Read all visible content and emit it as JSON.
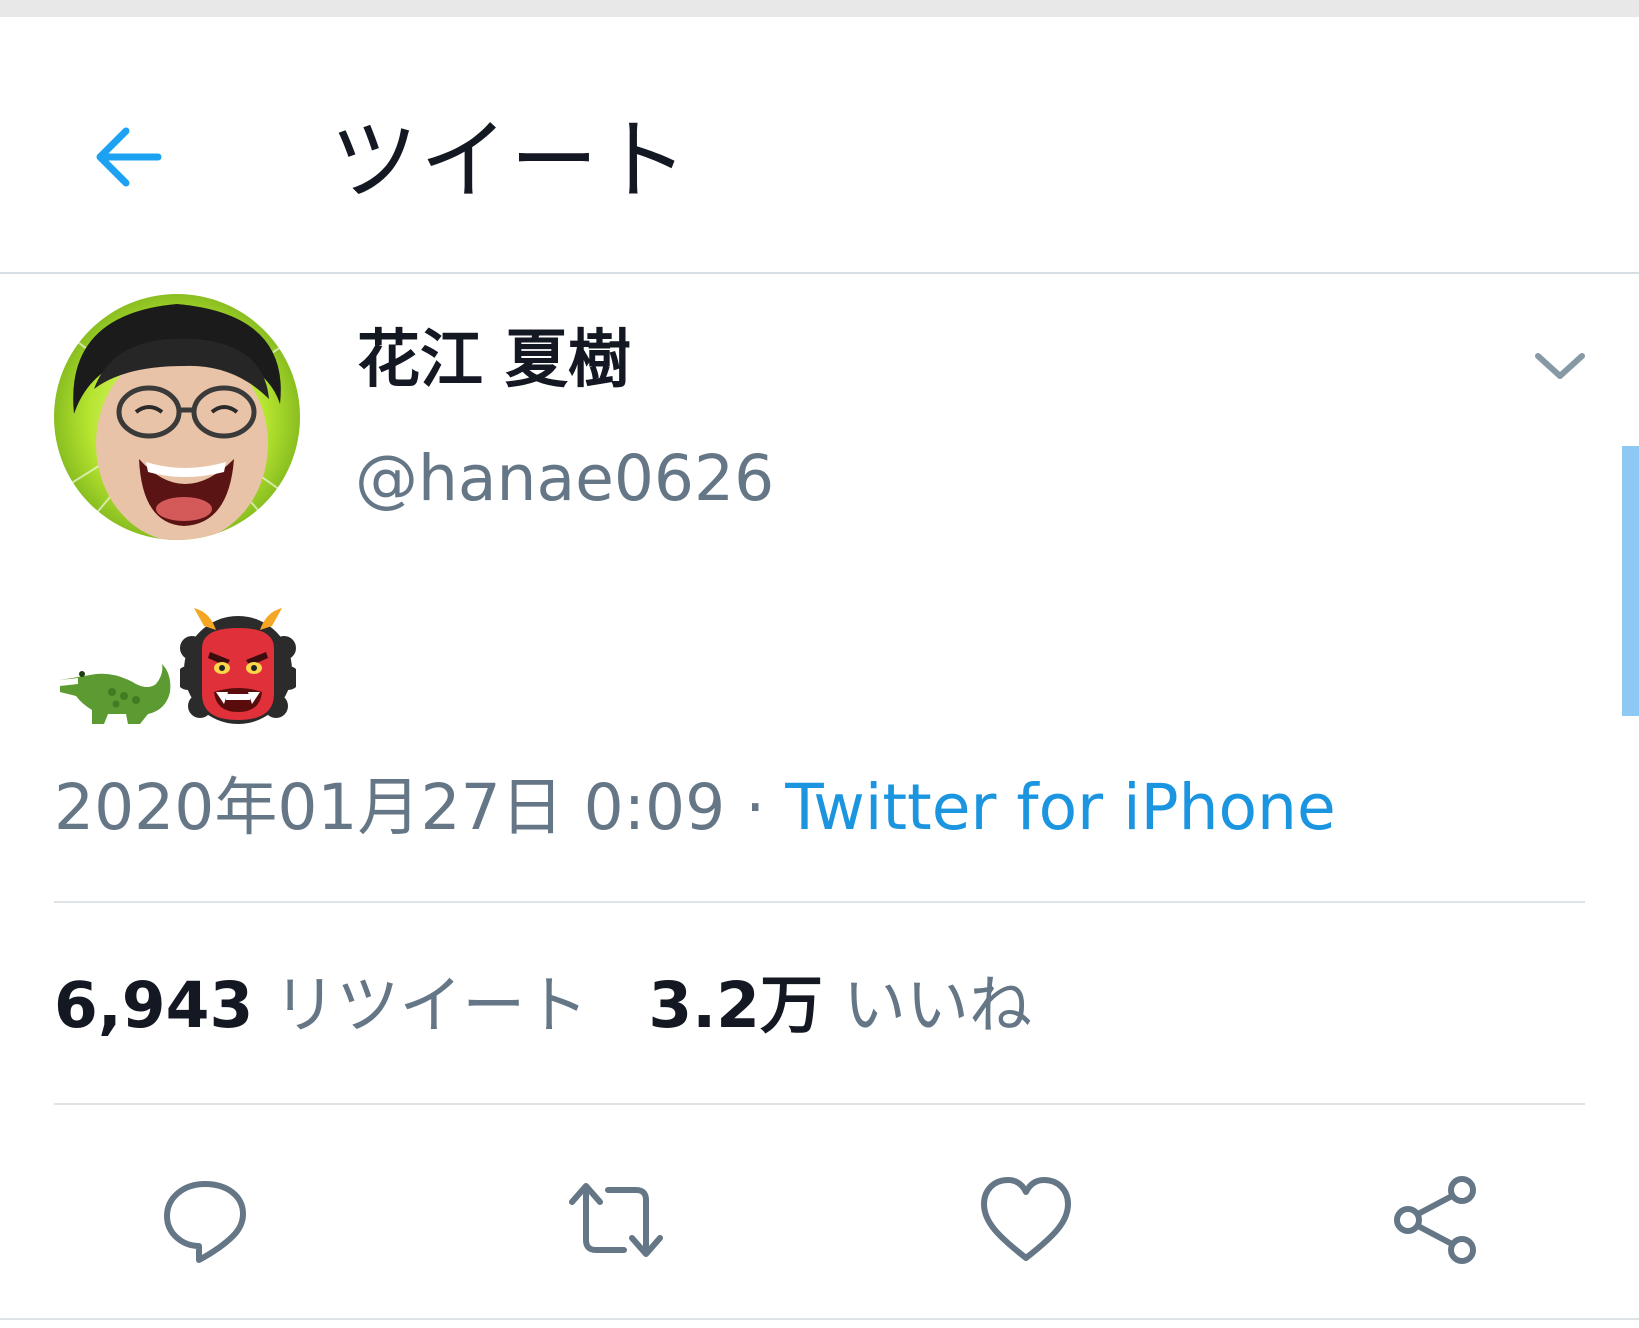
{
  "header": {
    "title": "ツイート",
    "back_icon": "arrow-left-icon",
    "accent_color": "#1da1f2"
  },
  "tweet": {
    "author": {
      "display_name": "花江 夏樹",
      "handle": "@hanae0626"
    },
    "body_emoji": [
      "crocodile",
      "japanese-ogre"
    ],
    "timestamp": "2020年01月27日 0:09",
    "separator": " · ",
    "source": "Twitter for iPhone",
    "stats": {
      "retweets_count": "6,943",
      "retweets_label": "リツイート",
      "likes_count": "3.2万",
      "likes_label": "いいね"
    }
  },
  "actions": [
    {
      "name": "reply",
      "icon": "reply-icon"
    },
    {
      "name": "retweet",
      "icon": "retweet-icon"
    },
    {
      "name": "like",
      "icon": "heart-icon"
    },
    {
      "name": "share",
      "icon": "share-icon"
    }
  ],
  "colors": {
    "text_primary": "#141823",
    "text_secondary": "#657786",
    "link": "#1b95e0",
    "divider": "#dde3e7"
  }
}
